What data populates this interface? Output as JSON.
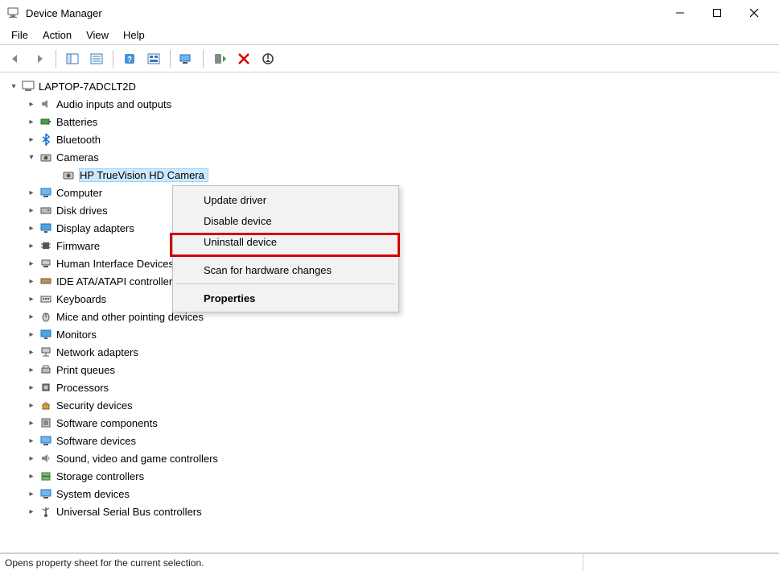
{
  "window": {
    "title": "Device Manager"
  },
  "menu": {
    "file": "File",
    "action": "Action",
    "view": "View",
    "help": "Help"
  },
  "tree": {
    "root": "LAPTOP-7ADCLT2D",
    "audio": "Audio inputs and outputs",
    "batteries": "Batteries",
    "bluetooth": "Bluetooth",
    "cameras": "Cameras",
    "camera_child": "HP TrueVision HD Camera",
    "computer": "Computer",
    "disks": "Disk drives",
    "display": "Display adapters",
    "firmware": "Firmware",
    "hid": "Human Interface Devices",
    "ide": "IDE ATA/ATAPI controllers",
    "keyboards": "Keyboards",
    "mice": "Mice and other pointing devices",
    "monitors": "Monitors",
    "network": "Network adapters",
    "print": "Print queues",
    "processors": "Processors",
    "security": "Security devices",
    "swcomp": "Software components",
    "swdev": "Software devices",
    "sound": "Sound, video and game controllers",
    "storage": "Storage controllers",
    "system": "System devices",
    "usb": "Universal Serial Bus controllers"
  },
  "context_menu": {
    "update": "Update driver",
    "disable": "Disable device",
    "uninstall": "Uninstall device",
    "scan": "Scan for hardware changes",
    "properties": "Properties"
  },
  "status": "Opens property sheet for the current selection."
}
